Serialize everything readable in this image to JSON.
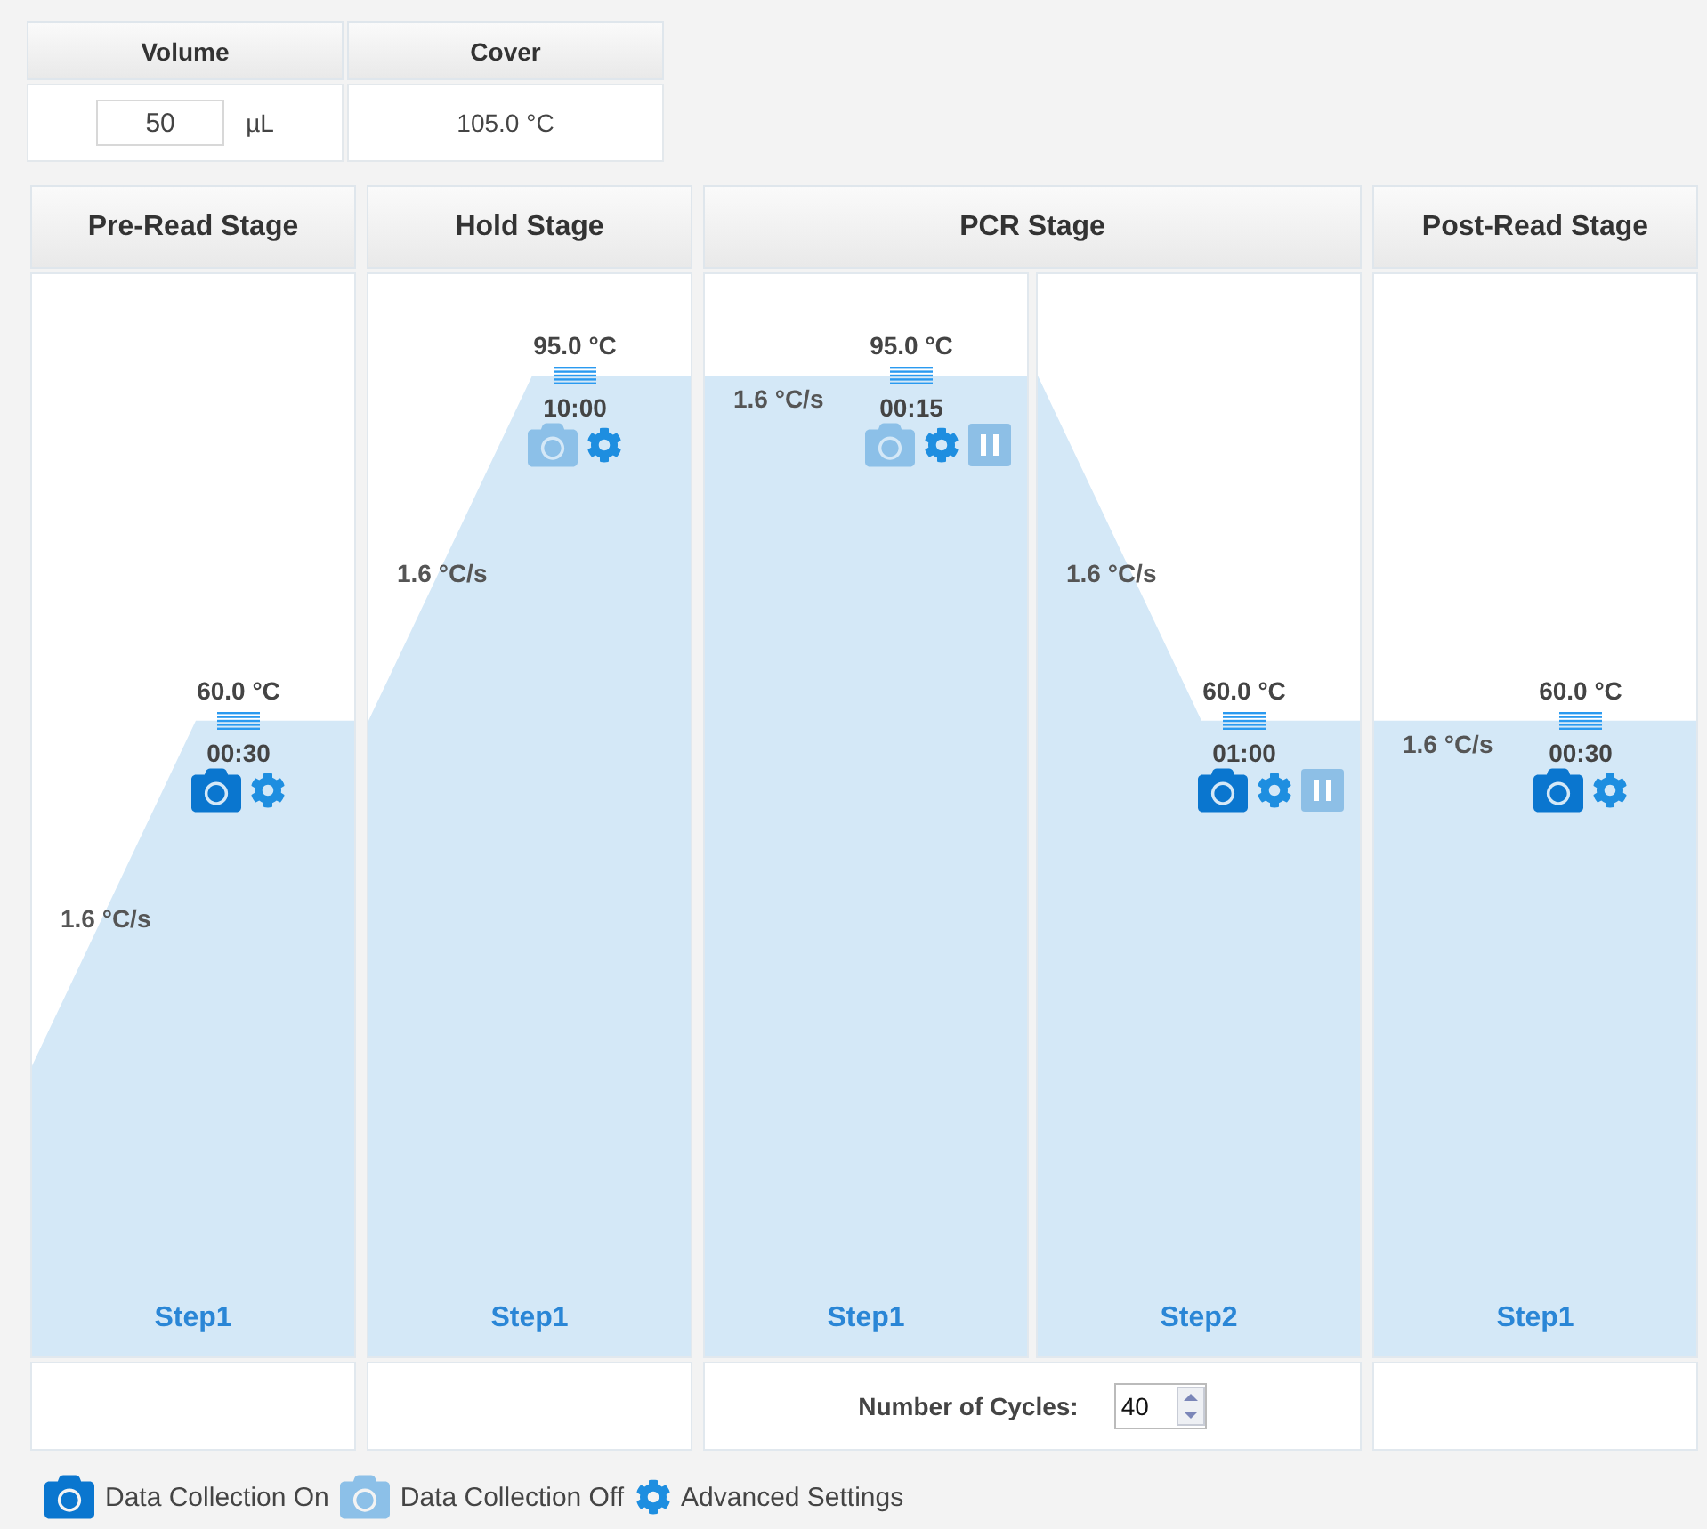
{
  "settings_table": {
    "columns": [
      {
        "header": "Volume",
        "kind": "input",
        "value": "50",
        "unit": "µL"
      },
      {
        "header": "Cover",
        "kind": "text",
        "value": "105.0 °C"
      }
    ]
  },
  "stages": [
    {
      "title": "Pre-Read Stage",
      "steps": [
        {
          "label": "Step1",
          "temperature": "60.0 °C",
          "time": "00:30",
          "ramp_rate": "1.6 °C/s",
          "data_collection": true,
          "pause": false
        }
      ]
    },
    {
      "title": "Hold Stage",
      "steps": [
        {
          "label": "Step1",
          "temperature": "95.0 °C",
          "time": "10:00",
          "ramp_rate": "1.6 °C/s",
          "data_collection": false,
          "pause": false
        }
      ]
    },
    {
      "title": "PCR Stage",
      "steps": [
        {
          "label": "Step1",
          "temperature": "95.0 °C",
          "time": "00:15",
          "ramp_rate": "1.6 °C/s",
          "data_collection": false,
          "pause": true
        },
        {
          "label": "Step2",
          "temperature": "60.0 °C",
          "time": "01:00",
          "ramp_rate": "1.6 °C/s",
          "data_collection": true,
          "pause": true
        }
      ],
      "footer": {
        "cycles_label": "Number of Cycles:",
        "cycles": "40"
      }
    },
    {
      "title": "Post-Read Stage",
      "steps": [
        {
          "label": "Step1",
          "temperature": "60.0 °C",
          "time": "00:30",
          "ramp_rate": "1.6 °C/s",
          "data_collection": true,
          "pause": false
        }
      ]
    }
  ],
  "legend": [
    {
      "kind": "camera_on",
      "label": "Data Collection On"
    },
    {
      "kind": "camera_off",
      "label": "Data Collection Off"
    },
    {
      "kind": "gear",
      "label": "Advanced Settings"
    }
  ]
}
